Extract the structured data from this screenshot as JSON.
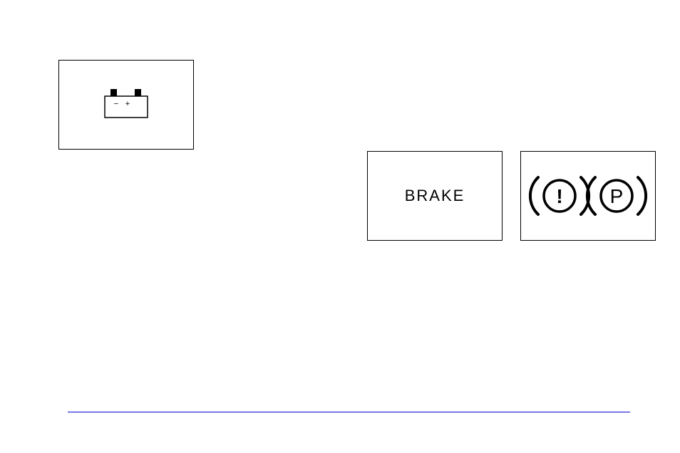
{
  "battery": {
    "minus": "−",
    "plus": "+"
  },
  "brake": {
    "label": "BRAKE"
  },
  "parking": {
    "excl": "!",
    "p": "P"
  }
}
